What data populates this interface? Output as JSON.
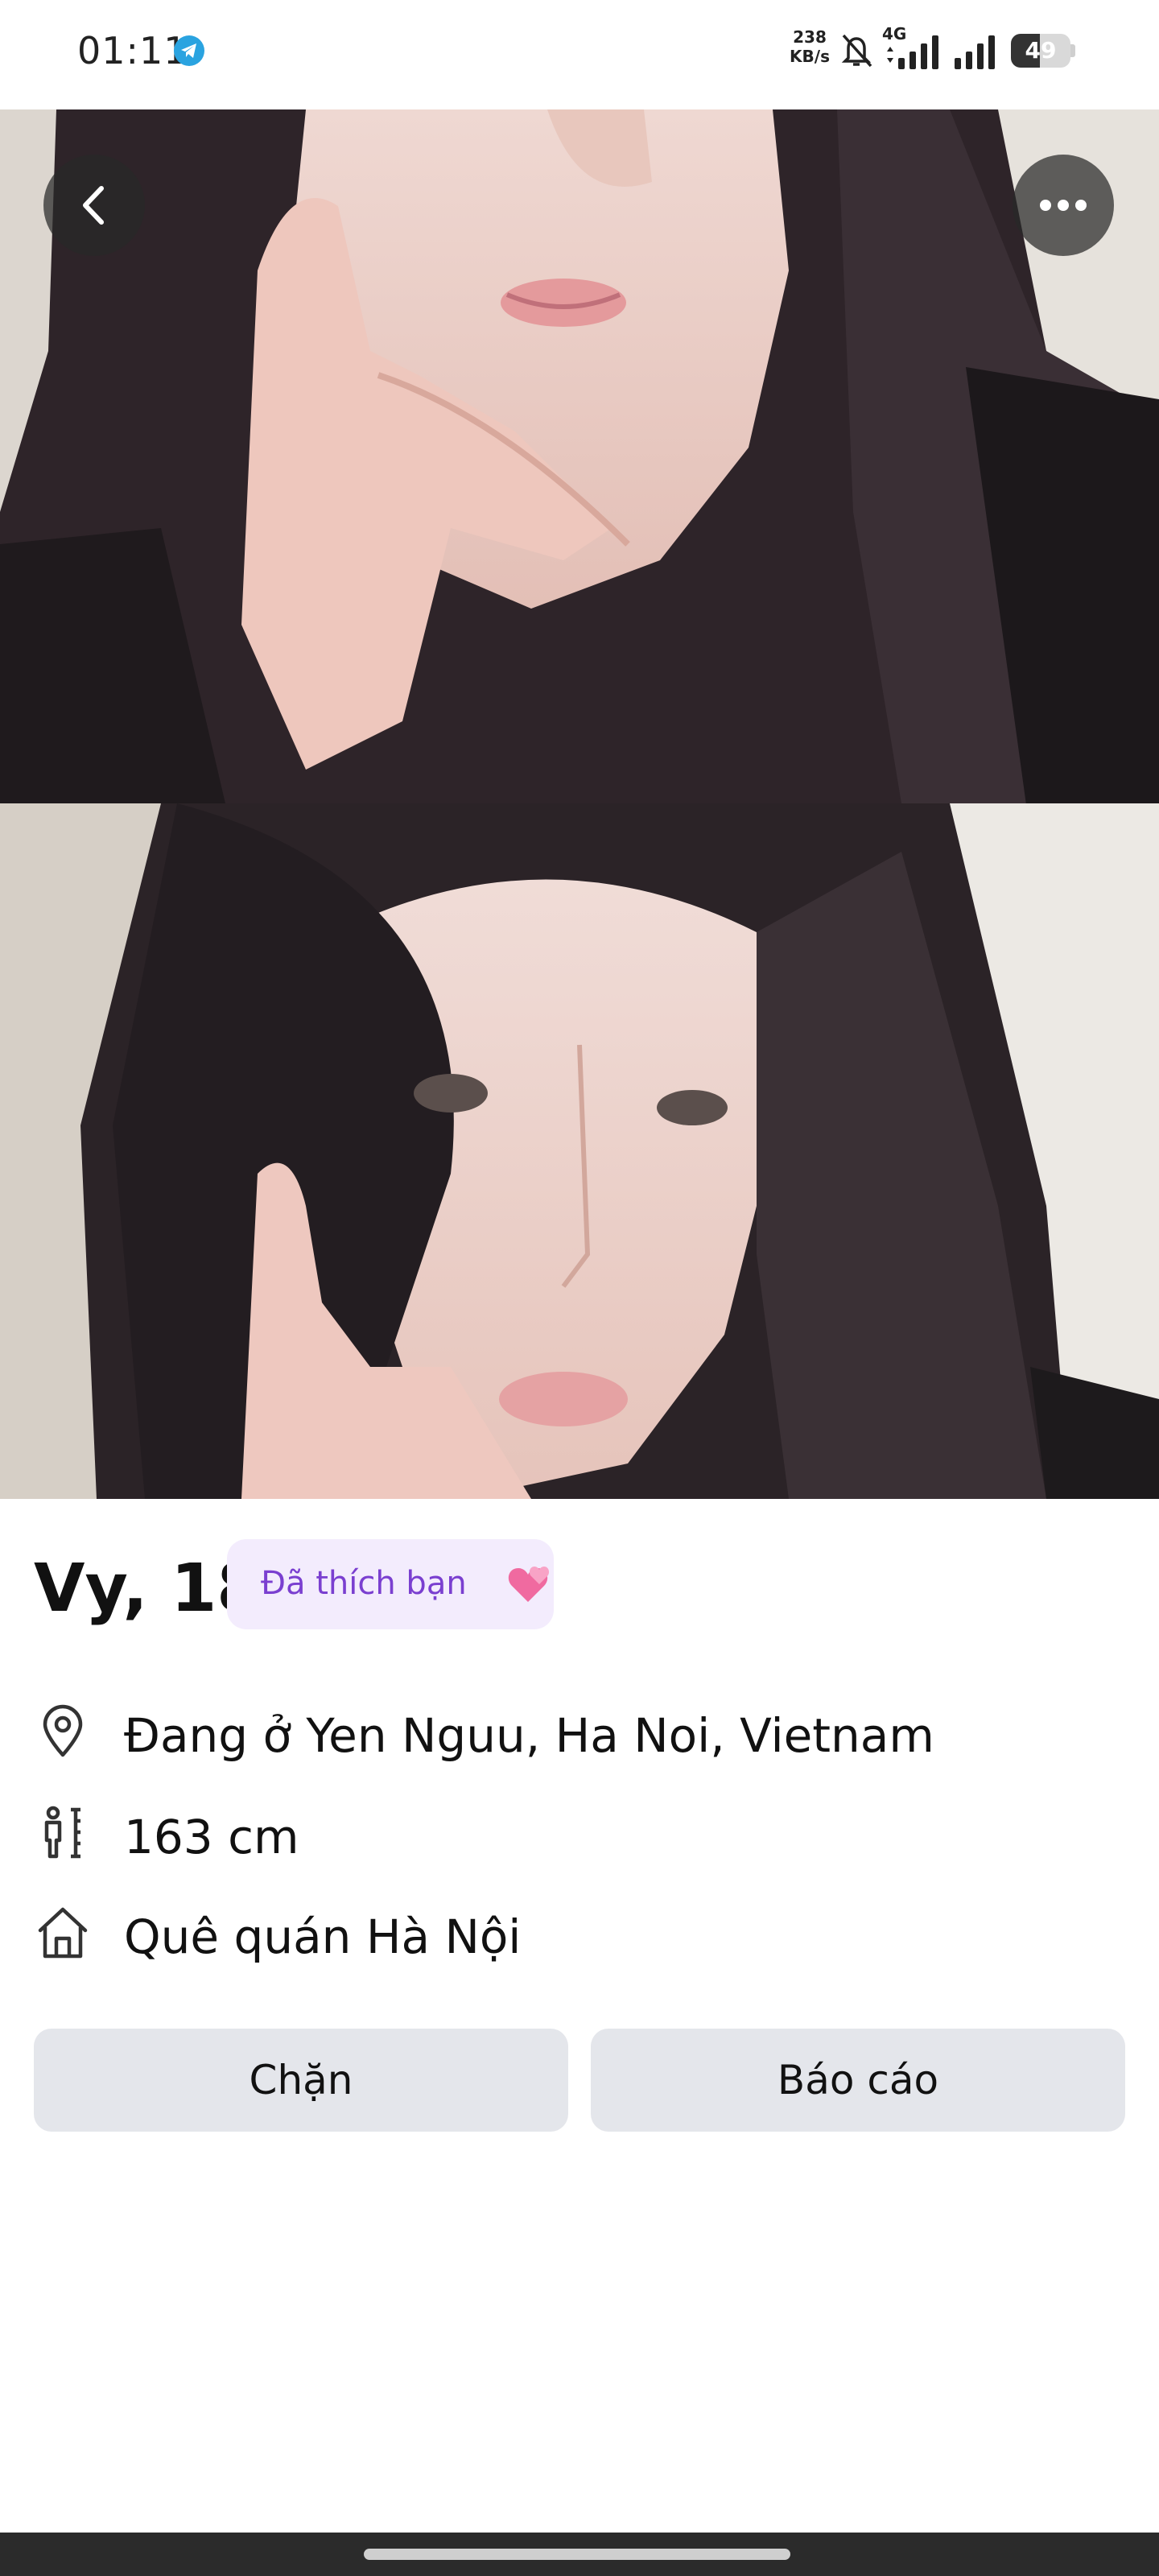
{
  "status_bar": {
    "time": "01:11",
    "net_speed_value": "238",
    "net_speed_unit": "KB/s",
    "network_type": "4G",
    "battery_level": "49",
    "battery_fraction": 0.49,
    "icons": [
      "telegram-icon",
      "mute-bell-icon",
      "signal-icon",
      "signal-icon",
      "battery-icon"
    ]
  },
  "photos": {
    "photo_1_description": "",
    "photo_2_description": ""
  },
  "header_buttons": {
    "back_icon": "chevron-left-icon",
    "more_icon": "more-horizontal-icon"
  },
  "profile": {
    "name_age": "Vy, 18",
    "liked_badge": "Đã thích bạn",
    "liked_badge_icon": "two-hearts-icon",
    "location": "Đang ở Yen Nguu, Ha Noi, Vietnam",
    "height": "163 cm",
    "hometown": "Quê quán Hà Nội"
  },
  "actions": {
    "block_label": "Chặn",
    "report_label": "Báo cáo"
  },
  "colors": {
    "badge_bg": "#f3ecfd",
    "badge_text": "#7a3fd0",
    "button_bg": "#e4e6eb",
    "telegram_blue": "#2aa3e0"
  }
}
